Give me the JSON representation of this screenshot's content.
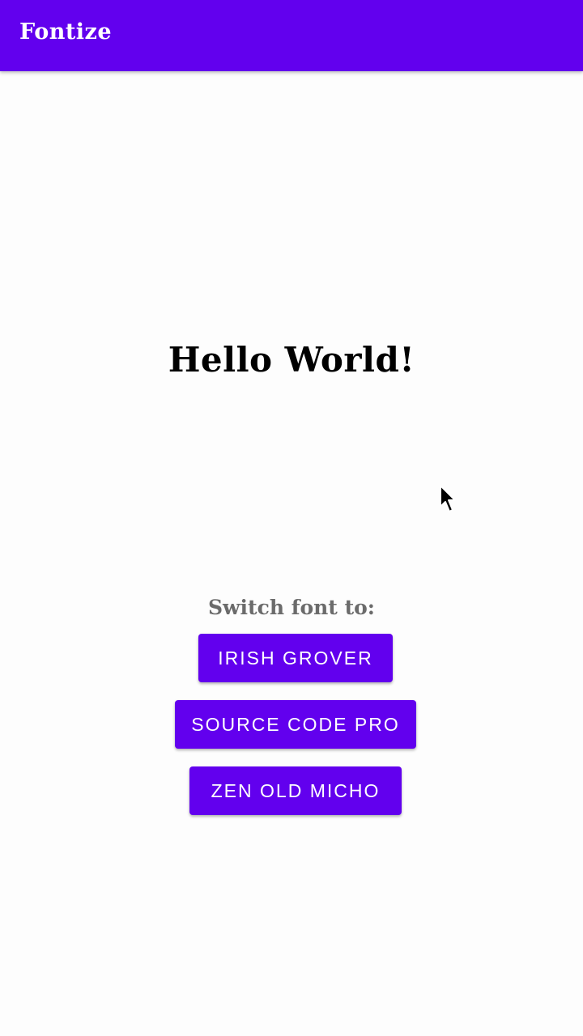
{
  "app_bar": {
    "title": "Fontize",
    "color": "#6200ee"
  },
  "main": {
    "greeting": "Hello World!",
    "switch_label": "Switch font to:"
  },
  "buttons": [
    {
      "label": "IRISH GROVER"
    },
    {
      "label": "SOURCE CODE PRO"
    },
    {
      "label": "ZEN OLD MICHO"
    }
  ],
  "cursor": {
    "icon": "mouse-pointer-icon"
  }
}
